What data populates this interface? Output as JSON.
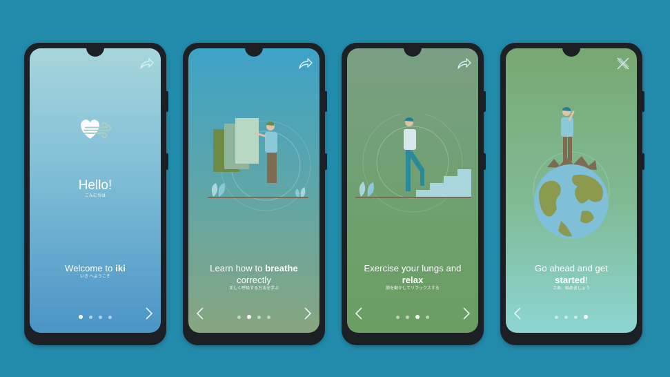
{
  "colors": {
    "background": "#228aab"
  },
  "screens": [
    {
      "heading": "Hello!",
      "heading_jp": "こんにちは",
      "line1": "Welcome to ",
      "line1_bold": "iki",
      "line2": "",
      "line2_bold": "",
      "line2_tail": "",
      "subtitle_jp": "いき へようこそ",
      "top_icon": "share-arrow-icon",
      "active_dot": 0,
      "gradient": [
        "#a7d6dc",
        "#4a94c6"
      ]
    },
    {
      "line1": "Learn how to ",
      "line1_bold": "breathe",
      "line2": "correctly",
      "line2_bold": "",
      "line2_tail": "",
      "subtitle_jp": "正しく呼吸する方法を学ぶ",
      "top_icon": "share-arrow-icon",
      "active_dot": 1,
      "gradient": [
        "#3ea2c7",
        "#88a67f"
      ]
    },
    {
      "line1": "Exercise your lungs and",
      "line1_bold": "",
      "line2": "",
      "line2_bold": "relax",
      "line2_tail": "",
      "subtitle_jp": "肺を動かしてリラックスする",
      "top_icon": "share-arrow-icon",
      "active_dot": 2,
      "gradient": [
        "#7a9f84",
        "#6a9e62"
      ]
    },
    {
      "line1": "Go ahead and get",
      "line1_bold": "",
      "line2": "",
      "line2_bold": "started",
      "line2_tail": "!",
      "subtitle_jp": "さあ、始めましょう",
      "top_icon": "close-x-icon",
      "active_dot": 3,
      "gradient": [
        "#78a872",
        "#8cd5d2"
      ]
    }
  ]
}
